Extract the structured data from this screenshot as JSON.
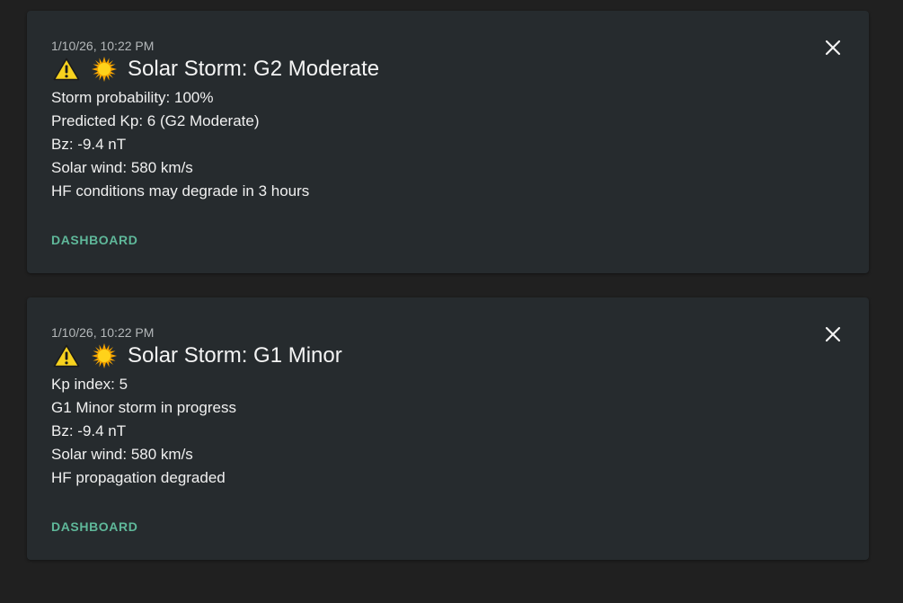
{
  "notifications": [
    {
      "timestamp": "1/10/26, 10:22 PM",
      "title": "Solar Storm: G2 Moderate",
      "lines": [
        "Storm probability: 100%",
        "Predicted Kp: 6 (G2 Moderate)",
        "Bz: -9.4 nT",
        "Solar wind: 580 km/s",
        "HF conditions may degrade in 3 hours"
      ],
      "action_label": "DASHBOARD",
      "icons": [
        "warning-icon",
        "sun-icon",
        "close-icon"
      ]
    },
    {
      "timestamp": "1/10/26, 10:22 PM",
      "title": "Solar Storm: G1 Minor",
      "lines": [
        "Kp index: 5",
        "G1 Minor storm in progress",
        "Bz: -9.4 nT",
        "Solar wind: 580 km/s",
        "HF propagation degraded"
      ],
      "action_label": "DASHBOARD",
      "icons": [
        "warning-icon",
        "sun-icon",
        "close-icon"
      ]
    }
  ],
  "colors": {
    "background": "#202020",
    "card": "#262b2e",
    "action": "#5fb89a",
    "warning": "#f7d21e",
    "sun": "#f5c211"
  }
}
